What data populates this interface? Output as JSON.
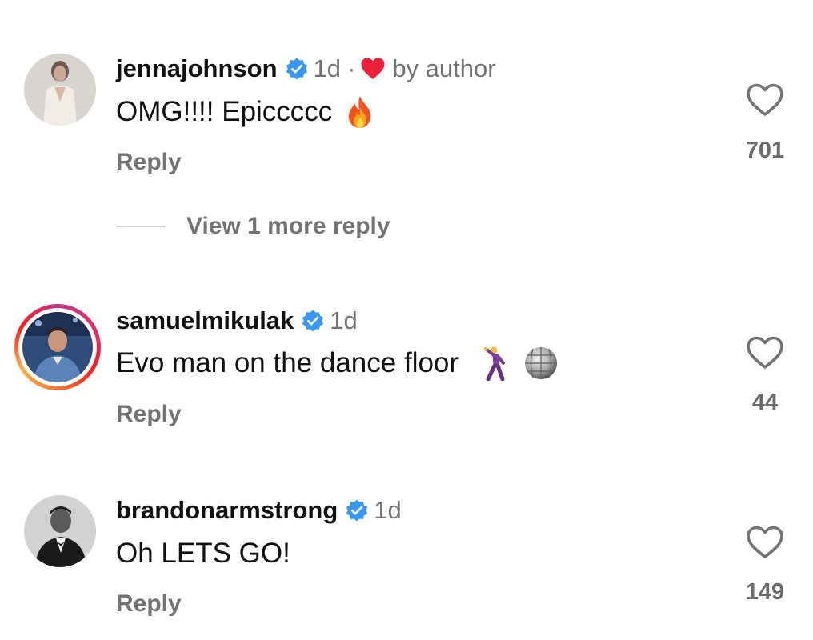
{
  "comments": [
    {
      "username": "jennajohnson",
      "time": "1d",
      "separator": "·",
      "author_badge": "by author",
      "text": "OMG!!!! Epiccccc",
      "emojis": [
        "fire-emoji"
      ],
      "reply_label": "Reply",
      "likes": "701",
      "view_more": "View 1 more reply"
    },
    {
      "username": "samuelmikulak",
      "time": "1d",
      "text": "Evo man on the dance floor",
      "emojis": [
        "man-dancing-emoji",
        "mirror-ball-emoji"
      ],
      "reply_label": "Reply",
      "likes": "44"
    },
    {
      "username": "brandonarmstrong",
      "time": "1d",
      "text": "Oh LETS GO!",
      "reply_label": "Reply",
      "likes": "149"
    }
  ],
  "colors": {
    "verified": "#3897f0",
    "author_heart": "#ed1f3a",
    "secondary_text": "#737373"
  }
}
